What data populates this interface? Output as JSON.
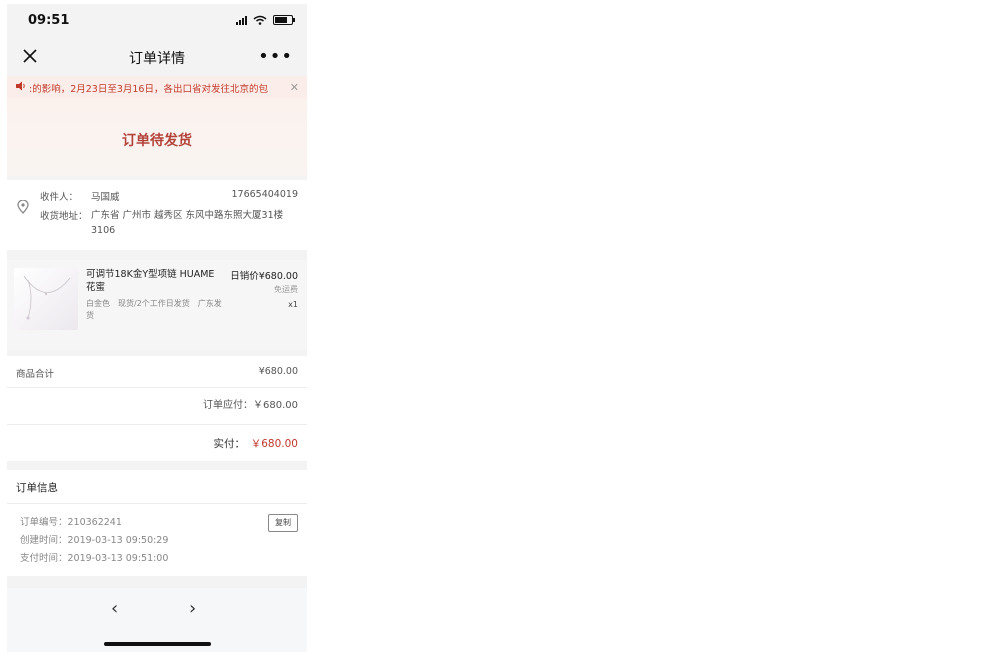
{
  "status_bar": {
    "time": "09:51"
  },
  "nav": {
    "title": "订单详情",
    "more": "•••"
  },
  "notice": {
    "text": ":的影响，2月23日至3月16日，各出口省对发往北京的包",
    "close": "✕"
  },
  "banner": {
    "status": "订单待发货"
  },
  "address": {
    "recipient_label": "收件人：",
    "recipient_name": "马国威",
    "phone": "17665404019",
    "address_label": "收货地址：",
    "address_text": "广东省 广州市 越秀区 东风中路东照大厦31楼3106"
  },
  "product": {
    "title": "可调节18K金Y型项链 HUAME 花蜜",
    "price": "日销价¥680.00",
    "shipping": "免运费",
    "spec": "白金色　现货/2个工作日发货　广东发货",
    "qty": "x1"
  },
  "totals": {
    "subtotal_label": "商品合计",
    "subtotal_value": "¥680.00",
    "due": "订单应付：￥680.00",
    "paid_label": "实付：",
    "paid_value": "￥680.00"
  },
  "order_info": {
    "title": "订单信息",
    "number": "订单编号：210362241",
    "created": "创建时间：2019-03-13 09:50:29",
    "paid_time": "支付时间：2019-03-13 09:51:00",
    "copy": "复制"
  },
  "bottom": {
    "back": "‹",
    "forward": "›"
  }
}
